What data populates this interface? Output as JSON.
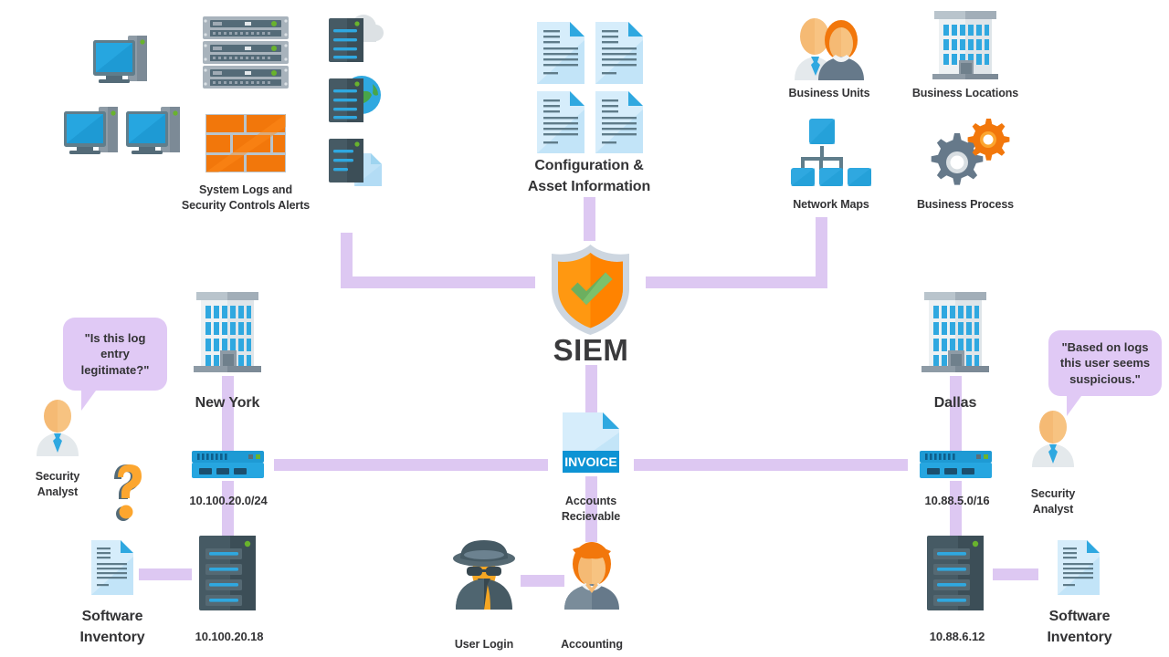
{
  "diagram": {
    "title": "SIEM",
    "center": {
      "label": "SIEM",
      "icon": "shield-check-icon",
      "shield_color": "#FF9811",
      "check_color": "#6CAF5F",
      "rim_color": "#CDD6E0"
    },
    "accent_connector_color": "#ddc8f2",
    "text_color": "#333335"
  },
  "inputs": {
    "system_logs": {
      "label": "System Logs and\nSecurity Controls Alerts"
    },
    "configuration": {
      "label": "Configuration &\nAsset Information"
    },
    "business_units": {
      "label": "Business Units"
    },
    "business_locations": {
      "label": "Business Locations"
    },
    "network_maps": {
      "label": "Network Maps"
    },
    "business_process": {
      "label": "Business Process"
    }
  },
  "sites": {
    "left": {
      "city": "New York",
      "subnet": "10.100.20.0/24",
      "server_ip": "10.100.20.18",
      "inventory_label": "Software\nInventory",
      "analyst_label": "Security\nAnalyst",
      "quote": "\"Is this log entry legitimate?\"",
      "question_icon": "question-mark-icon"
    },
    "right": {
      "city": "Dallas",
      "subnet": "10.88.5.0/16",
      "server_ip": "10.88.6.12",
      "inventory_label": "Software\nInventory",
      "analyst_label": "Security\nAnalyst",
      "quote": "\"Based on logs this user seems suspicious.\""
    }
  },
  "middle": {
    "invoice": {
      "label": "Accounts\nRecievable",
      "badge": "INVOICE"
    },
    "user_login": {
      "label": "User Login",
      "icon": "spy-icon"
    },
    "accounting": {
      "label": "Accounting",
      "icon": "person-orange-hair-icon"
    }
  },
  "colors": {
    "blue": "#26A6E0",
    "blue_dark": "#1A8CC4",
    "orange": "#F2770B",
    "orange_light": "#FCA62F",
    "slate": "#465A64",
    "slate_dark": "#37474F",
    "gray_light": "#E8EDF0",
    "green_led": "#69B32D",
    "doc_blue": "#BFE2F7"
  }
}
